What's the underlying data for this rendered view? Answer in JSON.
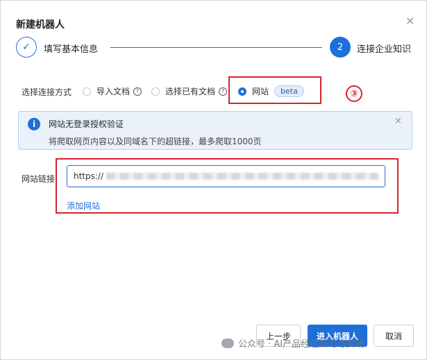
{
  "dialog": {
    "title": "新建机器人",
    "close_glyph": "×"
  },
  "steps": {
    "step1": {
      "check_glyph": "✓",
      "label": "填写基本信息"
    },
    "step2": {
      "number": "2",
      "label": "连接企业知识"
    }
  },
  "connection": {
    "label": "选择连接方式",
    "options": [
      {
        "label": "导入文档",
        "help": "?"
      },
      {
        "label": "选择已有文档",
        "help": "?"
      },
      {
        "label": "网站",
        "badge": "beta"
      }
    ],
    "selected": "网站"
  },
  "annotation": {
    "marker": "③"
  },
  "banner": {
    "icon": "i",
    "title": "网站无登录授权验证",
    "description": "将爬取网页内容以及同域名下的超链接，最多爬取1000页",
    "close_glyph": "×"
  },
  "website": {
    "label": "网站链接",
    "url_value": "https://",
    "add_link": "添加网站"
  },
  "footer": {
    "prev": "上一步",
    "enter": "进入机器人",
    "cancel": "取消"
  },
  "watermark": "公众号 · AI产品经理研习与实践",
  "colors": {
    "primary": "#1f6fd8",
    "annotation_red": "#d9212a"
  }
}
